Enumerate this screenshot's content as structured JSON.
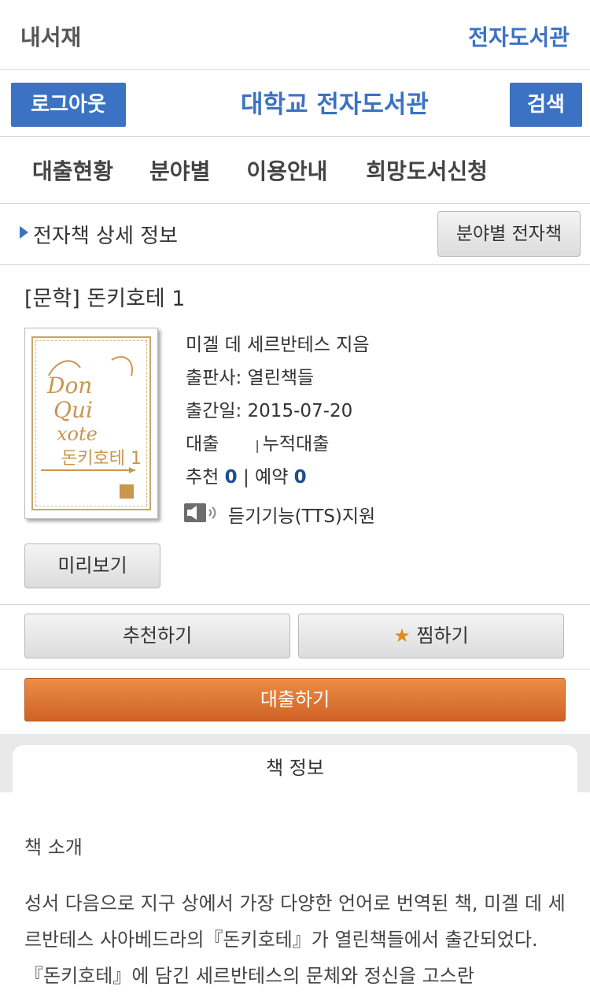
{
  "topbar": {
    "left": "내서재",
    "right": "전자도서관"
  },
  "header": {
    "logout": "로그아웃",
    "title": "대학교 전자도서관",
    "search": "검색"
  },
  "nav": [
    "대출현황",
    "분야별",
    "이용안내",
    "희망도서신청"
  ],
  "section": {
    "title": "전자책 상세 정보",
    "category_button": "분야별 전자책"
  },
  "book": {
    "title": "[문학] 돈키호테 1",
    "author": "미겔 데 세르반테스 지음",
    "publisher": "출판사: 열린책들",
    "pub_date": "출간일: 2015-07-20",
    "loan_label": "대출",
    "loan_sep": "|",
    "cumulative_label": "누적대출",
    "recommend_label": "추천",
    "recommend_count": "0",
    "sep": "|",
    "reserve_label": "예약",
    "reserve_count": "0",
    "tts": "듣기기능(TTS)지원",
    "cover_text": [
      "Don",
      "Qui",
      "xote",
      "돈키호테 1"
    ]
  },
  "buttons": {
    "preview": "미리보기",
    "recommend": "추천하기",
    "wish": "찜하기",
    "loan": "대출하기"
  },
  "tabs": {
    "info": "책 정보"
  },
  "intro": {
    "heading": "책 소개",
    "text": "성서 다음으로 지구 상에서 가장 다양한 언어로 번역된 책, 미겔 데 세르반테스 사아베드라의『돈키호테』가 열린책들에서 출간되었다.『돈키호테』에 담긴 세르반테스의 문체와 정신을 고스란"
  }
}
